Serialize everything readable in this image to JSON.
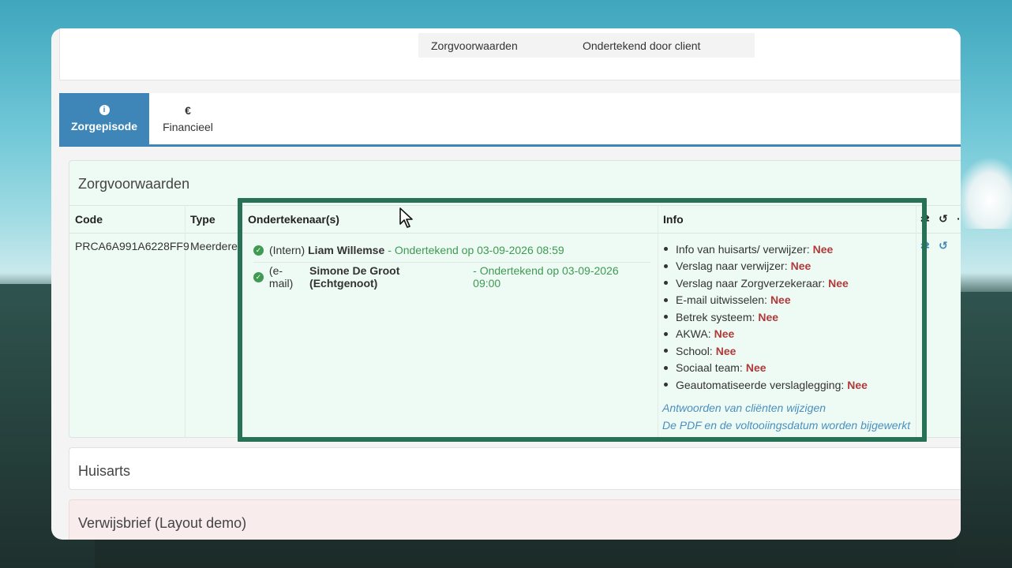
{
  "top_row": {
    "label": "Zorgvoorwaarden",
    "value": "Ondertekend door client"
  },
  "tabs": [
    {
      "icon": "info-icon",
      "icon_glyph": "i",
      "label": "Zorgepisode",
      "active": true
    },
    {
      "icon": "euro-icon",
      "icon_glyph": "€",
      "label": "Financieel",
      "active": false
    }
  ],
  "zorg_card": {
    "title": "Zorgvoorwaarden",
    "headers": {
      "code": "Code",
      "type": "Type",
      "signers": "Ondertekenaar(s)",
      "info": "Info"
    },
    "row": {
      "code": "PRCA6A991A6228FF9",
      "type": "Meerdere",
      "signers": [
        {
          "channel": "(Intern)",
          "name": "Liam Willemse",
          "status": "- Ondertekend op 03-09-2026 08:59"
        },
        {
          "channel": "(e-mail)",
          "name": "Simone De Groot (Echtgenoot)",
          "status": "- Ondertekend op 03-09-2026 09:00"
        }
      ],
      "info_items": [
        {
          "label": "Info van huisarts/ verwijzer:",
          "value": "Nee"
        },
        {
          "label": "Verslag naar verwijzer:",
          "value": "Nee"
        },
        {
          "label": "Verslag naar Zorgverzekeraar:",
          "value": "Nee"
        },
        {
          "label": "E-mail uitwisselen:",
          "value": "Nee"
        },
        {
          "label": "Betrek systeem:",
          "value": "Nee"
        },
        {
          "label": "AKWA:",
          "value": "Nee"
        },
        {
          "label": "School:",
          "value": "Nee"
        },
        {
          "label": "Sociaal team:",
          "value": "Nee"
        },
        {
          "label": "Geautomatiseerde verslaglegging:",
          "value": "Nee"
        }
      ],
      "links": {
        "edit_answers": "Antwoorden van cliënten wijzigen",
        "pdf_update": "De PDF en de voltooiingsdatum worden bijgewerkt"
      }
    }
  },
  "huisarts_card": {
    "title": "Huisarts"
  },
  "verwijsbrief_card": {
    "title": "Verwijsbrief (Layout demo)"
  },
  "colors": {
    "accent": "#3e86b8",
    "success": "#3d9a50",
    "negative": "#b03a3a",
    "highlight": "#277257"
  }
}
